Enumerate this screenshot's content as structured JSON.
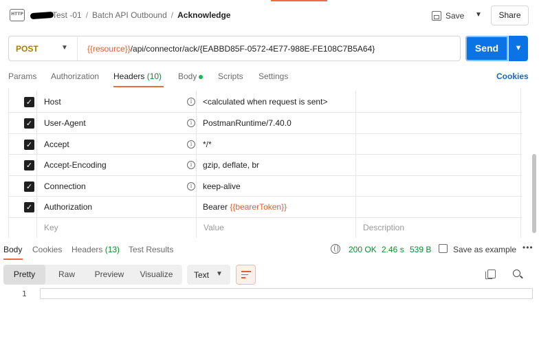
{
  "header": {
    "http_icon_text": "HTTP",
    "breadcrumb": [
      "Ristei Test -01",
      "Batch API Outbound",
      "Acknowledge"
    ],
    "breadcrumb_visible_first": "Test -01",
    "save_label": "Save",
    "share_label": "Share"
  },
  "request": {
    "method": "POST",
    "url_var": "{{resource}}",
    "url_path": "/api/connector/ack/{EABBD85F-0572-4E77-988E-FE108C7B5A64}",
    "send_label": "Send"
  },
  "tabs": {
    "params": "Params",
    "authorization": "Authorization",
    "headers": "Headers",
    "headers_count": "(10)",
    "body": "Body",
    "scripts": "Scripts",
    "settings": "Settings",
    "cookies": "Cookies"
  },
  "headers_table": {
    "rows": [
      {
        "key": "Host",
        "value": "<calculated when request is sent>"
      },
      {
        "key": "User-Agent",
        "value": "PostmanRuntime/7.40.0"
      },
      {
        "key": "Accept",
        "value": "*/*"
      },
      {
        "key": "Accept-Encoding",
        "value": "gzip, deflate, br"
      },
      {
        "key": "Connection",
        "value": "keep-alive"
      },
      {
        "key": "Authorization",
        "value_prefix": "Bearer ",
        "value_var": "{{bearerToken}}"
      }
    ],
    "placeholders": {
      "key": "Key",
      "value": "Value",
      "description": "Description"
    }
  },
  "response": {
    "tabs": {
      "body": "Body",
      "cookies": "Cookies",
      "headers": "Headers",
      "headers_count": "(13)",
      "test_results": "Test Results"
    },
    "status": "200 OK",
    "time": "2.46 s",
    "size": "539 B",
    "save_example": "Save as example",
    "more": "•••",
    "views": [
      "Pretty",
      "Raw",
      "Preview",
      "Visualize"
    ],
    "format": "Text",
    "line_number": "1"
  },
  "colors": {
    "accent": "#f26b3a",
    "send_blue": "#0b73e6",
    "method_post": "#ad7a03",
    "status_green": "#0a8b2a",
    "variable": "#e05d2b"
  }
}
